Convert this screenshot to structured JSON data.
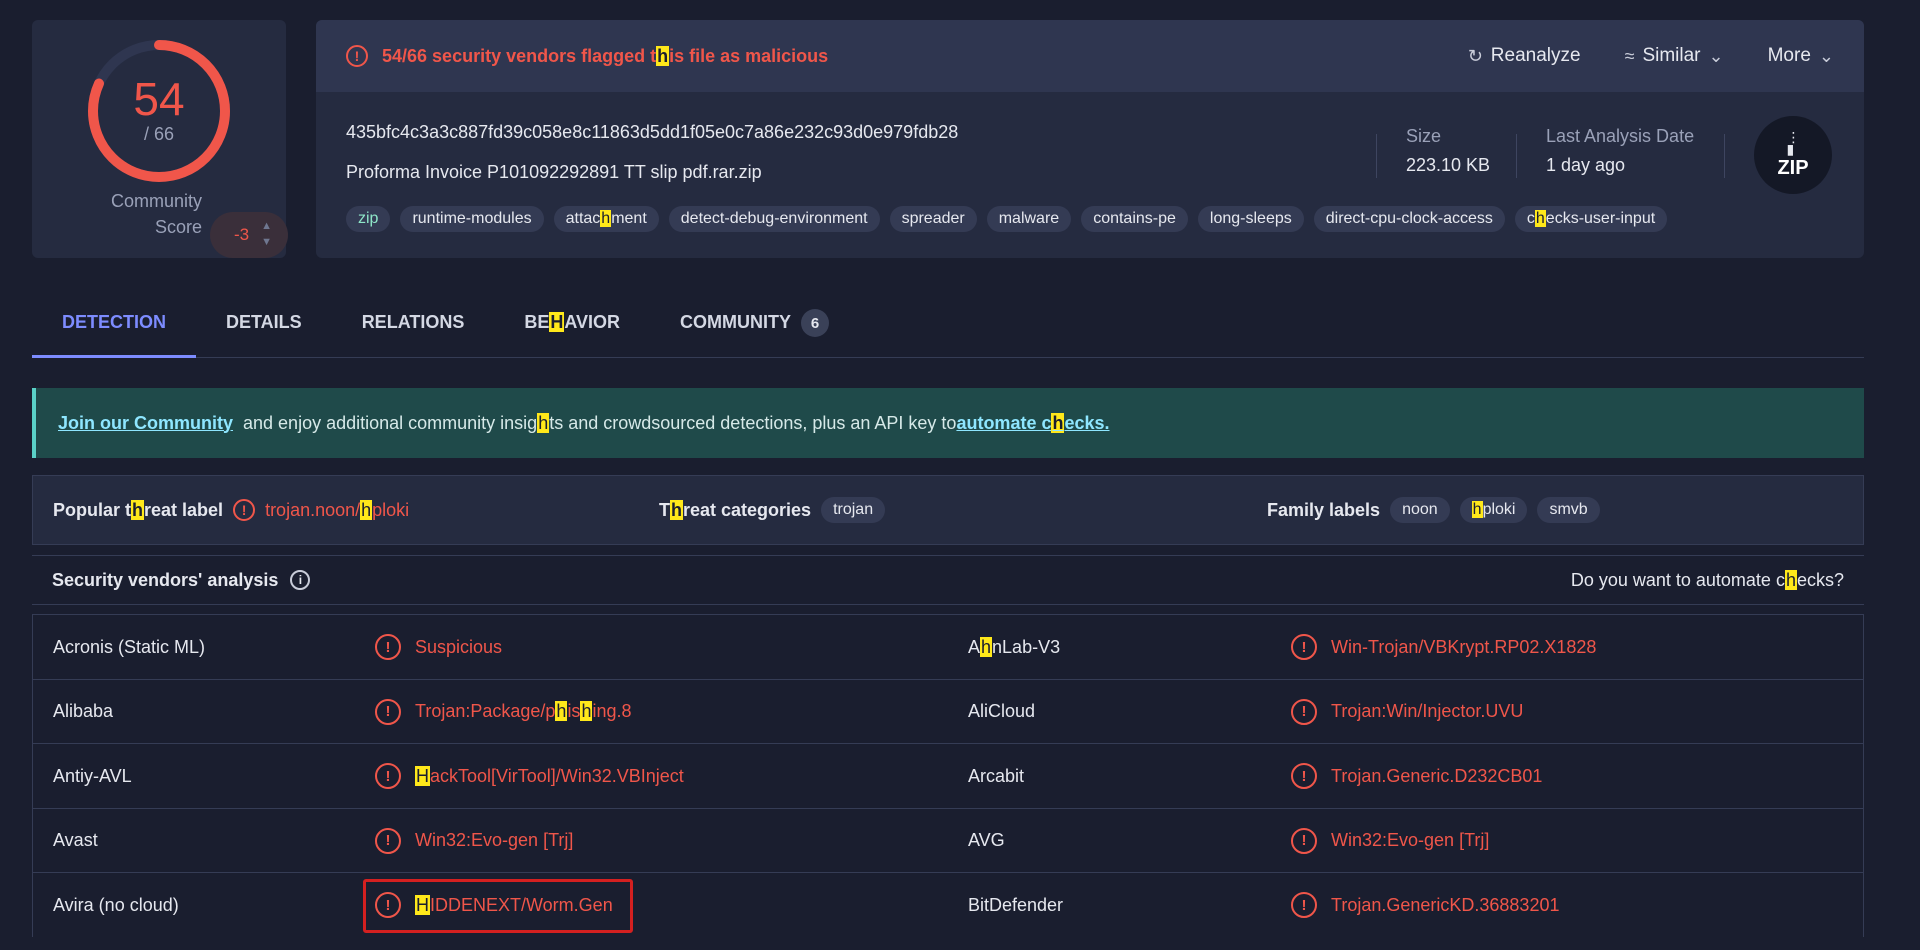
{
  "colors": {
    "background": "#1a1e2f",
    "card": "#252b40",
    "malicious": "#f0564a",
    "accent": "#7d8cff",
    "banner": "#1f4a4a"
  },
  "score": {
    "detected": "54",
    "total": "/ 66",
    "fraction": 0.818,
    "community_label_1": "Community",
    "community_label_2": "Score",
    "community_score": "-3"
  },
  "header": {
    "flag_pre": "54/66 security vendors flagged t",
    "flag_hl": "h",
    "flag_post": "is file as malicious",
    "reanalyze": "Reanalyze",
    "similar": "Similar",
    "more": "More"
  },
  "file": {
    "hash": "435bfc4c3a3c887fd39c058e8c11863d5dd1f05e0c7a86e232c93d0e979fdb28",
    "name": "Proforma Invoice P101092292891 TT slip pdf.rar.zip",
    "size_label": "Size",
    "size_value": "223.10 KB",
    "date_label": "Last Analysis Date",
    "date_value": "1 day ago",
    "type_badge": "ZIP"
  },
  "tags": [
    "zip",
    "runtime-modules",
    "attac|h|ment",
    "detect-debug-environment",
    "spreader",
    "malware",
    "contains-pe",
    "long-sleeps",
    "direct-cpu-clock-access",
    "c|h|ecks-user-input"
  ],
  "tabs": {
    "detection": "DETECTION",
    "details": "DETAILS",
    "relations": "RELATIONS",
    "behavior_pre": "BE",
    "behavior_hl": "H",
    "behavior_post": "AVIOR",
    "community": "COMMUNITY",
    "community_count": "6"
  },
  "banner": {
    "join": "Join our Community",
    "text_pre": " and enjoy additional community insig",
    "text_hl": "h",
    "text_post": "ts and crowdsourced detections, plus an API key to ",
    "link_pre": "automate c",
    "link_hl": "h",
    "link_post": "ecks."
  },
  "labels": {
    "popular_pre": "Popular t",
    "popular_hl": "h",
    "popular_post": "reat label",
    "popular_value_pre": "trojan.noon/",
    "popular_value_hl": "h",
    "popular_value_post": "ploki",
    "categories_pre": "T",
    "categories_hl": "h",
    "categories_post": "reat categories",
    "category_1": "trojan",
    "family_title": "Family labels",
    "family_1": "noon",
    "family_2_hl": "h",
    "family_2_post": "ploki",
    "family_3": "smvb"
  },
  "vendors": {
    "title": "Security vendors' analysis",
    "automate_pre": "Do you want to automate c",
    "automate_hl": "h",
    "automate_post": "ecks?",
    "rows": [
      {
        "v1": "Acronis (Static ML)",
        "r1": "Suspicious",
        "v2": "A|h|nLab-V3",
        "r2": "Win-Trojan/VBKrypt.RP02.X1828"
      },
      {
        "v1": "Alibaba",
        "r1": "Trojan:Package/p|h|is|h|ing.8",
        "v2": "AliCloud",
        "r2": "Trojan:Win/Injector.UVU"
      },
      {
        "v1": "Antiy-AVL",
        "r1": "|H|ackTool[VirTool]/Win32.VBInject",
        "v2": "Arcabit",
        "r2": "Trojan.Generic.D232CB01"
      },
      {
        "v1": "Avast",
        "r1": "Win32:Evo-gen [Trj]",
        "v2": "AVG",
        "r2": "Win32:Evo-gen [Trj]"
      },
      {
        "v1": "Avira (no cloud)",
        "r1": "|H|IDDENEXT/Worm.Gen",
        "v2": "BitDefender",
        "r2": "Trojan.GenericKD.36883201"
      }
    ]
  }
}
